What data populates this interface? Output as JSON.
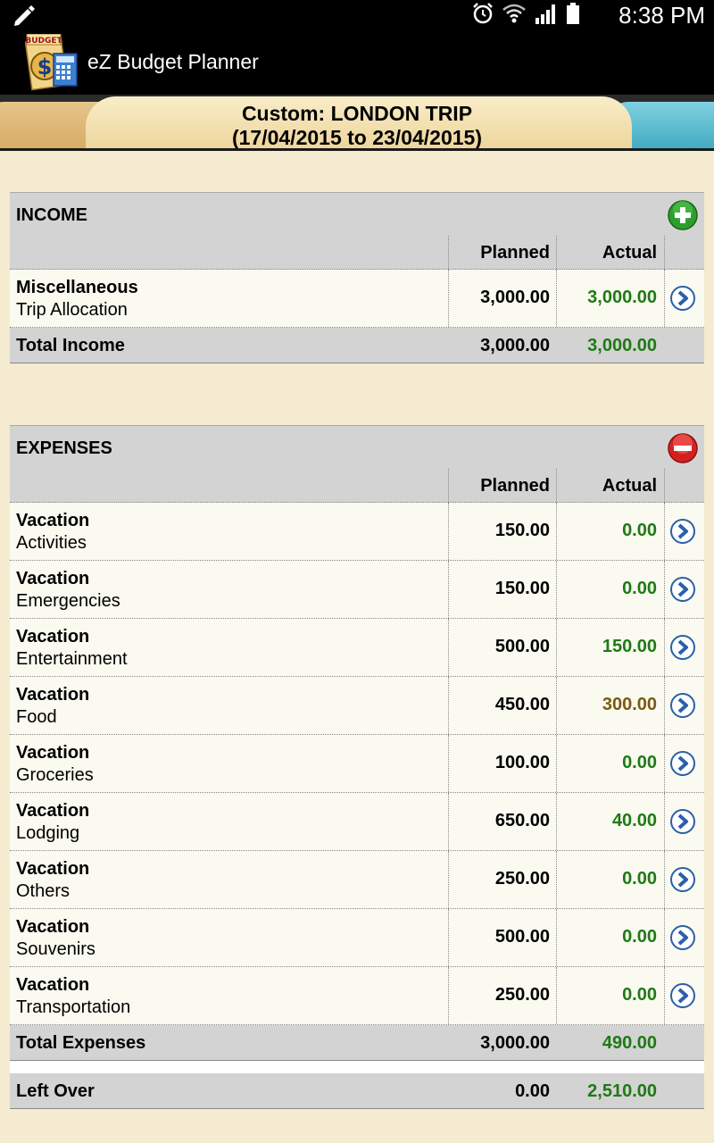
{
  "status_bar": {
    "time": "8:38 PM",
    "icons": [
      "pencil-icon",
      "alarm-icon",
      "wifi-icon",
      "signal-icon",
      "battery-icon"
    ]
  },
  "app": {
    "title": "eZ Budget Planner",
    "logo_text": "BUDGET"
  },
  "header": {
    "title": "Custom: LONDON TRIP",
    "date_range": "(17/04/2015 to 23/04/2015)"
  },
  "colors": {
    "background": "#f4ebd1",
    "section_header": "#d3d3d3",
    "row_background": "#fafaf0",
    "actual_ok": "#1e7a14",
    "actual_partial": "#7a5a10",
    "add_button": "#2e9e2e",
    "remove_button": "#d62020",
    "go_button": "#2c5fa8"
  },
  "income": {
    "title": "INCOME",
    "planned_header": "Planned",
    "actual_header": "Actual",
    "rows": [
      {
        "category": "Miscellaneous",
        "subcategory": "Trip Allocation",
        "planned": "3,000.00",
        "actual": "3,000.00"
      }
    ],
    "total_label": "Total Income",
    "total_planned": "3,000.00",
    "total_actual": "3,000.00"
  },
  "expenses": {
    "title": "EXPENSES",
    "planned_header": "Planned",
    "actual_header": "Actual",
    "rows": [
      {
        "category": "Vacation",
        "subcategory": "Activities",
        "planned": "150.00",
        "actual": "0.00"
      },
      {
        "category": "Vacation",
        "subcategory": "Emergencies",
        "planned": "150.00",
        "actual": "0.00"
      },
      {
        "category": "Vacation",
        "subcategory": "Entertainment",
        "planned": "500.00",
        "actual": "150.00"
      },
      {
        "category": "Vacation",
        "subcategory": "Food",
        "planned": "450.00",
        "actual": "300.00"
      },
      {
        "category": "Vacation",
        "subcategory": "Groceries",
        "planned": "100.00",
        "actual": "0.00"
      },
      {
        "category": "Vacation",
        "subcategory": "Lodging",
        "planned": "650.00",
        "actual": "40.00"
      },
      {
        "category": "Vacation",
        "subcategory": "Others",
        "planned": "250.00",
        "actual": "0.00"
      },
      {
        "category": "Vacation",
        "subcategory": "Souvenirs",
        "planned": "500.00",
        "actual": "0.00"
      },
      {
        "category": "Vacation",
        "subcategory": "Transportation",
        "planned": "250.00",
        "actual": "0.00"
      }
    ],
    "total_label": "Total Expenses",
    "total_planned": "3,000.00",
    "total_actual": "490.00"
  },
  "left_over": {
    "label": "Left Over",
    "planned": "0.00",
    "actual": "2,510.00"
  }
}
